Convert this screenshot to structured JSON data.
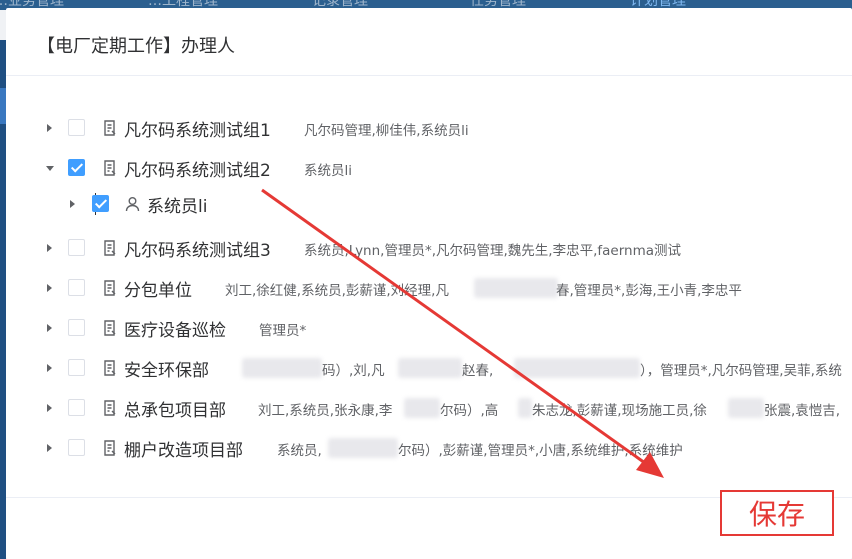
{
  "background_nav": [
    "…业务管理",
    "…工程管理",
    "记录管理",
    "任务管理",
    "计划管理"
  ],
  "dialog": {
    "title": "【电厂定期工作】办理人",
    "save_label": "保存"
  },
  "tree": [
    {
      "label": "凡尔码系统测试组1",
      "members": "凡尔码管理,柳佳伟,系统员li",
      "checked": false,
      "expanded": false
    },
    {
      "label": "凡尔码系统测试组2",
      "members": "系统员li",
      "checked": true,
      "expanded": true,
      "children": [
        {
          "label": "系统员li",
          "checked": true
        }
      ]
    },
    {
      "label": "凡尔码系统测试组3",
      "members": "系统员,Lynn,管理员*,凡尔码管理,魏先生,李忠平,faernma测试",
      "checked": false,
      "expanded": false
    },
    {
      "label": "分包单位",
      "members_a": "刘工,徐红健,系统员,彭薪谨,刘经理,凡",
      "members_b": "春,管理员*,彭海,王小青,李忠平",
      "checked": false,
      "expanded": false
    },
    {
      "label": "医疗设备巡检",
      "members": "管理员*",
      "checked": false,
      "expanded": false
    },
    {
      "label": "安全环保部",
      "members_a": "码）,刘,凡",
      "members_b": "赵春,",
      "members_c": "），管理员*,凡尔码管理,吴菲,系统",
      "checked": false,
      "expanded": false
    },
    {
      "label": "总承包项目部",
      "members_a": "刘工,系统员,张永康,李",
      "members_b": "尔码）,高",
      "members_c": "朱志龙,彭薪谨,现场施工员,徐",
      "members_d": "张震,袁愷吉,",
      "checked": false,
      "expanded": false
    },
    {
      "label": "棚户改造项目部",
      "members_a": "系统员,",
      "members_b": "尔码）,彭薪谨,管理员*,小唐,系统维护,系统维护",
      "checked": false,
      "expanded": false
    }
  ],
  "colors": {
    "primary": "#409eff",
    "annotation": "#e53935"
  },
  "icons": {
    "group": "group-document-icon",
    "user": "user-icon",
    "expand": "caret-icon"
  }
}
